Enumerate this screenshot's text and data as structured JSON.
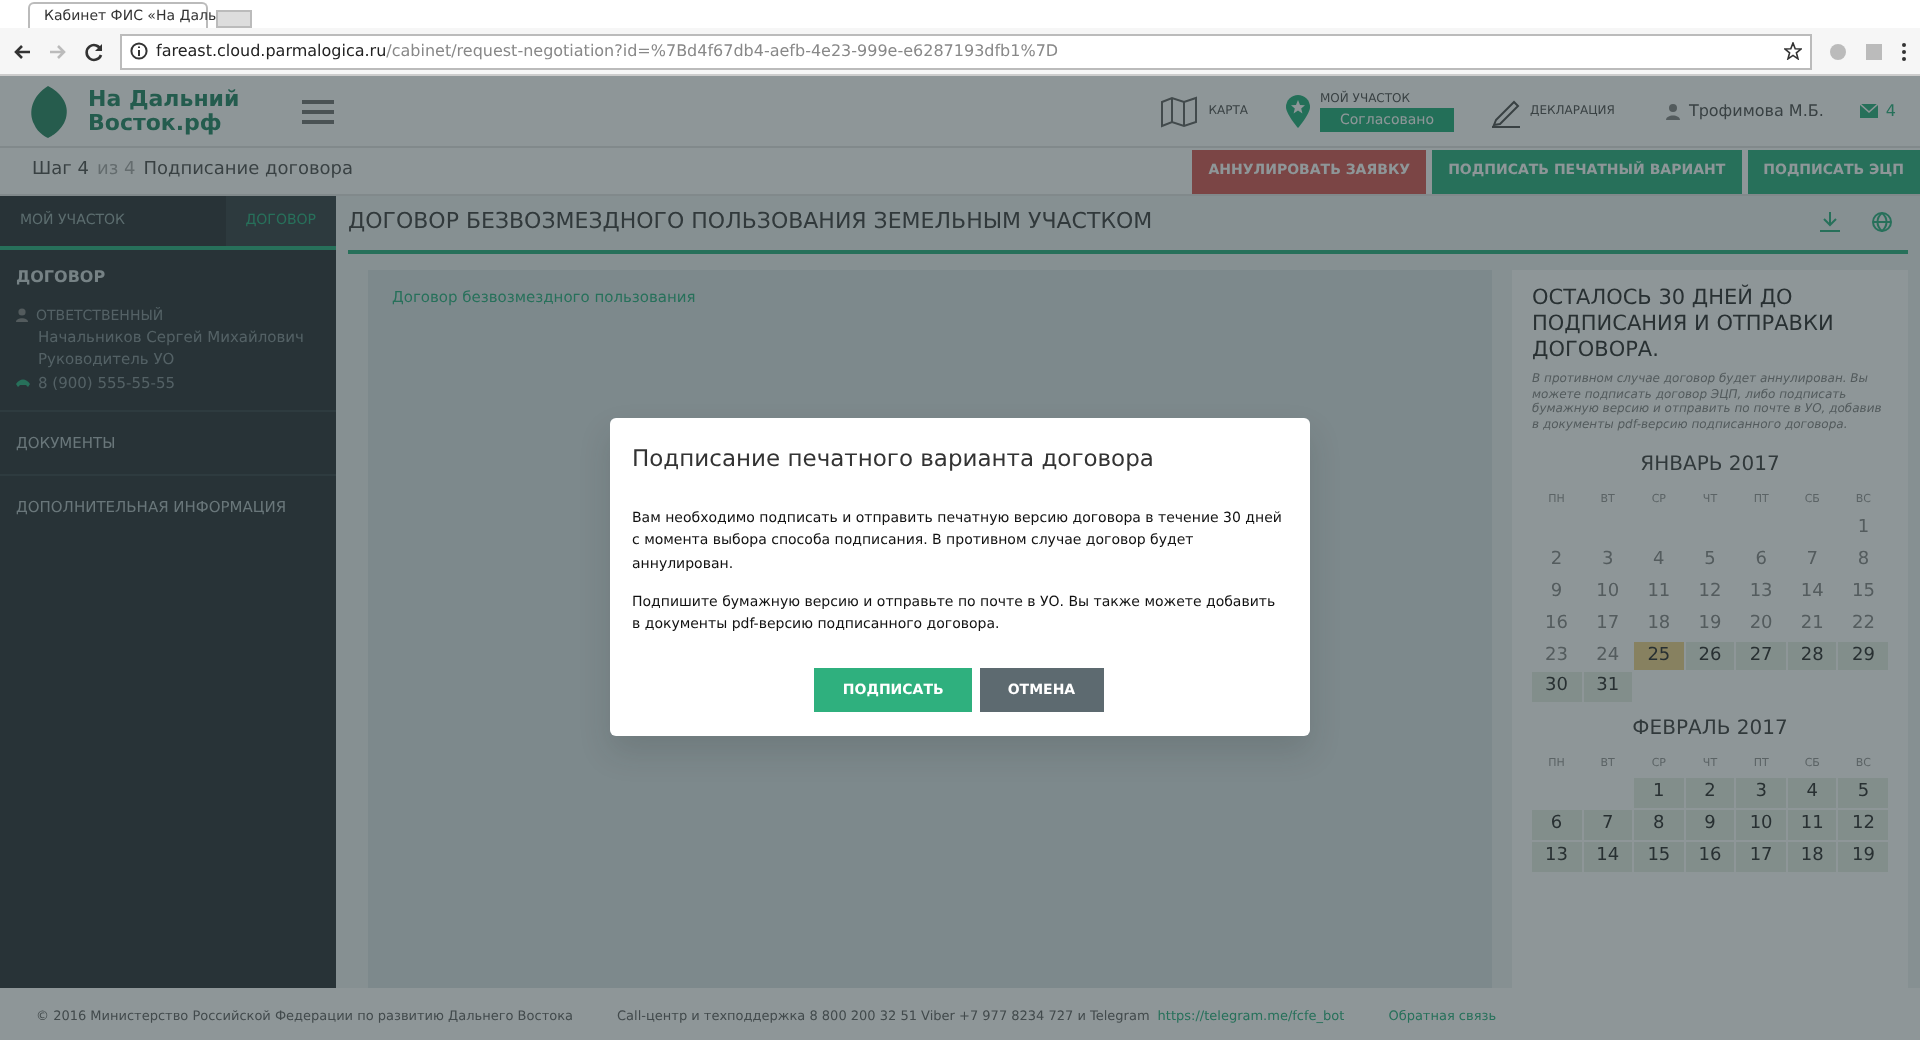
{
  "browser": {
    "tab_title": "Кабинет ФИС «На Даль",
    "url_host": "fareast.cloud.parmalogica.ru",
    "url_path": "/cabinet/request-negotiation?id=%7Bd4f67db4-aefb-4e23-999e-e6287193dfb1%7D"
  },
  "header": {
    "logo_text": "На Дальний Восток.рф",
    "nav": [
      {
        "kind": "map",
        "label": "КАРТА"
      },
      {
        "kind": "plot",
        "label": "МОЙ УЧАСТОК",
        "status": "Согласовано"
      },
      {
        "kind": "declaration",
        "label": "ДЕКЛАРАЦИЯ"
      }
    ],
    "user": "Трофимова М.Б.",
    "messages": "4"
  },
  "step": {
    "current": "Шаг 4",
    "of": "из 4",
    "title": "Подписание договора"
  },
  "actions": [
    {
      "kind": "danger",
      "label": "АННУЛИРОВАТЬ ЗАЯВКУ"
    },
    {
      "kind": "success",
      "label": "ПОДПИСАТЬ ПЕЧАТНЫЙ ВАРИАНТ"
    },
    {
      "kind": "success",
      "label": "ПОДПИСАТЬ ЭЦП"
    }
  ],
  "sidebar": {
    "tabs": [
      {
        "label": "МОЙ УЧАСТОК",
        "selected": false
      },
      {
        "label": "ДОГОВОР",
        "selected": true
      }
    ],
    "section_title": "ДОГОВОР",
    "responsible_label": "ОТВЕТСТВЕННЫЙ",
    "responsible_name": "Начальников Сергей Михайлович",
    "responsible_role": "Руководитель УО",
    "phone": "8 (900) 555-55-55",
    "links": [
      "ДОКУМЕНТЫ",
      "ДОПОЛНИТЕЛЬНАЯ ИНФОРМАЦИЯ"
    ]
  },
  "content": {
    "title": "ДОГОВОР БЕЗВОЗМЕЗДНОГО ПОЛЬЗОВАНИЯ ЗЕМЕЛЬНЫМ УЧАСТКОМ",
    "document_link": "Договор безвозмездного пользования"
  },
  "deadline": {
    "title": "ОСТАЛОСЬ 30 ДНЕЙ ДО ПОДПИСАНИЯ И ОТПРАВКИ ДОГОВОРА.",
    "note": "В противном случае договор будет аннулирован. Вы можете подписать договор ЭЦП, либо подписать бумажную версию и отправить по почте в УО, добавив в документы pdf-версию подписанного договора.",
    "calendars": [
      {
        "title": "ЯНВАРЬ 2017",
        "weekdays": [
          "ПН",
          "ВТ",
          "СР",
          "ЧТ",
          "ПТ",
          "СБ",
          "ВС"
        ],
        "days": [
          {
            "kind": "empty"
          },
          {
            "kind": "empty"
          },
          {
            "kind": "empty"
          },
          {
            "kind": "empty"
          },
          {
            "kind": "empty"
          },
          {
            "kind": "empty"
          },
          {
            "kind": "past",
            "label": "1"
          },
          {
            "kind": "past",
            "label": "2"
          },
          {
            "kind": "past",
            "label": "3"
          },
          {
            "kind": "past",
            "label": "4"
          },
          {
            "kind": "past",
            "label": "5"
          },
          {
            "kind": "past",
            "label": "6"
          },
          {
            "kind": "past",
            "label": "7"
          },
          {
            "kind": "past",
            "label": "8"
          },
          {
            "kind": "past",
            "label": "9"
          },
          {
            "kind": "past",
            "label": "10"
          },
          {
            "kind": "past",
            "label": "11"
          },
          {
            "kind": "past",
            "label": "12"
          },
          {
            "kind": "past",
            "label": "13"
          },
          {
            "kind": "past",
            "label": "14"
          },
          {
            "kind": "past",
            "label": "15"
          },
          {
            "kind": "past",
            "label": "16"
          },
          {
            "kind": "past",
            "label": "17"
          },
          {
            "kind": "past",
            "label": "18"
          },
          {
            "kind": "past",
            "label": "19"
          },
          {
            "kind": "past",
            "label": "20"
          },
          {
            "kind": "past",
            "label": "21"
          },
          {
            "kind": "past",
            "label": "22"
          },
          {
            "kind": "past",
            "label": "23"
          },
          {
            "kind": "past",
            "label": "24"
          },
          {
            "kind": "today",
            "label": "25"
          },
          {
            "kind": "window",
            "label": "26"
          },
          {
            "kind": "window",
            "label": "27"
          },
          {
            "kind": "window",
            "label": "28"
          },
          {
            "kind": "window",
            "label": "29"
          },
          {
            "kind": "window",
            "label": "30"
          },
          {
            "kind": "window",
            "label": "31"
          }
        ]
      },
      {
        "title": "ФЕВРАЛЬ 2017",
        "weekdays": [
          "ПН",
          "ВТ",
          "СР",
          "ЧТ",
          "ПТ",
          "СБ",
          "ВС"
        ],
        "days": [
          {
            "kind": "empty"
          },
          {
            "kind": "empty"
          },
          {
            "kind": "window",
            "label": "1"
          },
          {
            "kind": "window",
            "label": "2"
          },
          {
            "kind": "window",
            "label": "3"
          },
          {
            "kind": "window",
            "label": "4"
          },
          {
            "kind": "window",
            "label": "5"
          },
          {
            "kind": "window",
            "label": "6"
          },
          {
            "kind": "window",
            "label": "7"
          },
          {
            "kind": "window",
            "label": "8"
          },
          {
            "kind": "window",
            "label": "9"
          },
          {
            "kind": "window",
            "label": "10"
          },
          {
            "kind": "window",
            "label": "11"
          },
          {
            "kind": "window",
            "label": "12"
          },
          {
            "kind": "window",
            "label": "13"
          },
          {
            "kind": "window",
            "label": "14"
          },
          {
            "kind": "window",
            "label": "15"
          },
          {
            "kind": "window",
            "label": "16"
          },
          {
            "kind": "window",
            "label": "17"
          },
          {
            "kind": "window",
            "label": "18"
          },
          {
            "kind": "window",
            "label": "19"
          }
        ]
      }
    ]
  },
  "footer": {
    "copyright": "© 2016 Министерство Российской Федерации по развитию Дальнего Востока",
    "support": "Call-центр и техподдержка 8 800 200 32 51   Viber +7 977 8234 727 и Telegram",
    "telegram_link": "https://telegram.me/fcfe_bot",
    "feedback": "Обратная связь"
  },
  "modal": {
    "title": "Подписание печатного варианта договора",
    "paragraphs": [
      "Вам необходимо подписать и отправить печатную версию договора в течение 30 дней с момента выбора способа подписания. В противном случае договор будет аннулирован.",
      "Подпишите бумажную версию и отправьте по почте в УО. Вы также можете добавить в документы pdf-версию подписанного договора."
    ],
    "buttons": [
      {
        "kind": "primary",
        "label": "ПОДПИСАТЬ"
      },
      {
        "kind": "secondary",
        "label": "ОТМЕНА"
      }
    ]
  }
}
